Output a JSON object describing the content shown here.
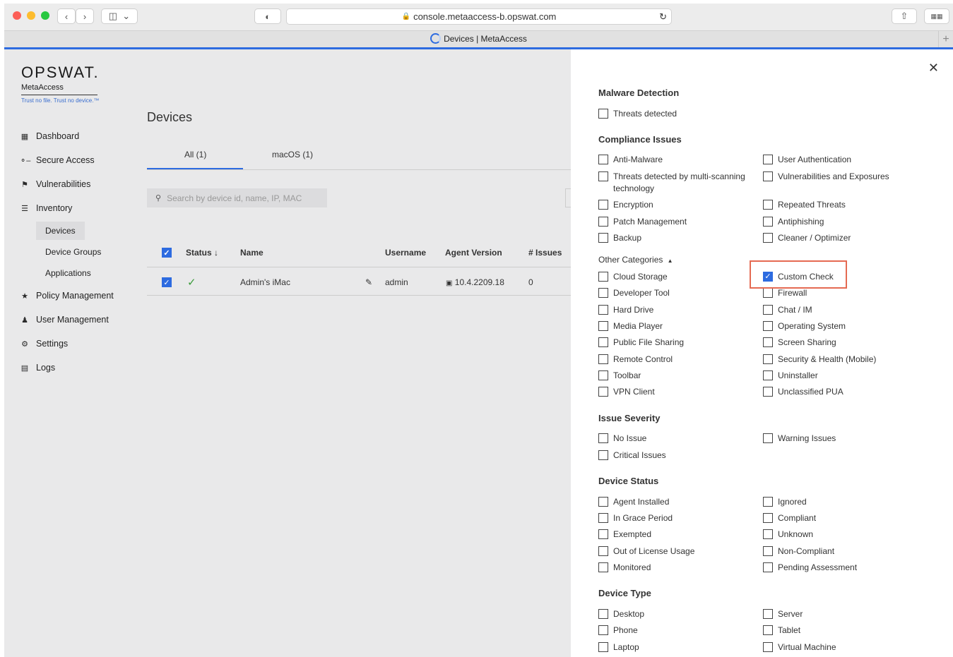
{
  "browser": {
    "url": "console.metaaccess-b.opswat.com",
    "tab_title": "Devices | MetaAccess",
    "new_tab": "+"
  },
  "logo": {
    "brand": "OPSWAT.",
    "product": "MetaAccess",
    "tagline": "Trust no file. Trust no device.™"
  },
  "sidebar": {
    "items": [
      {
        "label": "Dashboard",
        "icon": "grid-icon"
      },
      {
        "label": "Secure Access",
        "icon": "key-icon"
      },
      {
        "label": "Vulnerabilities",
        "icon": "flag-icon"
      },
      {
        "label": "Inventory",
        "icon": "list-icon"
      },
      {
        "label": "Policy Management",
        "icon": "star-icon"
      },
      {
        "label": "User Management",
        "icon": "users-icon"
      },
      {
        "label": "Settings",
        "icon": "gear-icon"
      },
      {
        "label": "Logs",
        "icon": "clipboard-icon"
      }
    ],
    "inventory_sub": [
      "Devices",
      "Device Groups",
      "Applications"
    ]
  },
  "main": {
    "title": "Devices",
    "tabs": [
      "All (1)",
      "macOS (1)"
    ],
    "search_placeholder": "Search by device id, name, IP, MAC",
    "columns": [
      "Status",
      "Name",
      "Username",
      "Agent Version",
      "# Issues"
    ],
    "sort_indicator": "↓",
    "rows": [
      {
        "status": "✓",
        "name": "Admin's iMac",
        "username": "admin",
        "agent_version": "10.4.2209.18",
        "issues": "0"
      }
    ]
  },
  "filter_panel": {
    "close": "✕",
    "malware_title": "Malware Detection",
    "malware": [
      "Threats detected"
    ],
    "compliance_title": "Compliance Issues",
    "compliance_left": [
      "Anti-Malware",
      "Threats detected by multi-scanning technology",
      "Encryption",
      "Patch Management",
      "Backup"
    ],
    "compliance_right": [
      "User Authentication",
      "Vulnerabilities and Exposures",
      "Repeated Threats",
      "Antiphishing",
      "Cleaner / Optimizer"
    ],
    "other_title": "Other Categories",
    "other_left": [
      "Cloud Storage",
      "Developer Tool",
      "Hard Drive",
      "Media Player",
      "Public File Sharing",
      "Remote Control",
      "Toolbar",
      "VPN Client"
    ],
    "other_right": [
      "Custom Check",
      "Firewall",
      "Chat / IM",
      "Operating System",
      "Screen Sharing",
      "Security & Health (Mobile)",
      "Uninstaller",
      "Unclassified PUA"
    ],
    "severity_title": "Issue Severity",
    "severity_left": [
      "No Issue",
      "Critical Issues"
    ],
    "severity_right": [
      "Warning Issues"
    ],
    "status_title": "Device Status",
    "status_left": [
      "Agent Installed",
      "In Grace Period",
      "Exempted",
      "Out of License Usage",
      "Monitored"
    ],
    "status_right": [
      "Ignored",
      "Compliant",
      "Unknown",
      "Non-Compliant",
      "Pending Assessment"
    ],
    "type_title": "Device Type",
    "type_left": [
      "Desktop",
      "Phone",
      "Laptop"
    ],
    "type_right": [
      "Server",
      "Tablet",
      "Virtual Machine"
    ],
    "checked": [
      "Custom Check"
    ]
  },
  "colors": {
    "accent": "#2d6be0",
    "highlight": "#e56a52"
  }
}
